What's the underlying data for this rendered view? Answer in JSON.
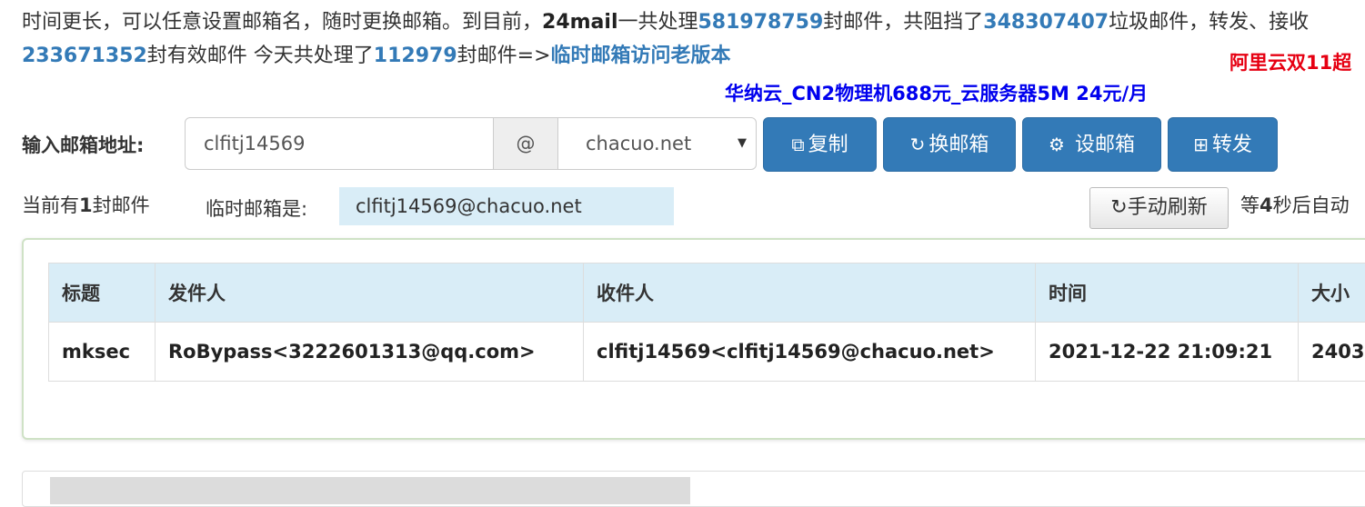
{
  "intro": {
    "line1_a": "时间更长，可以任意设置邮箱名，随时更换邮箱。到目前，",
    "brand": "24mail",
    "line1_b": "一共处理",
    "total": "581978759",
    "line1_c": "封邮件，共阻挡了",
    "blocked": "348307407",
    "line1_d": "垃圾邮件，转发、接收",
    "valid": "233671352",
    "line2_a": "封有效邮件 今天共处理了",
    "today": "112979",
    "line2_b": "封邮件=>",
    "old_version_link": "临时邮箱访问老版本"
  },
  "ads": {
    "aliyun": "阿里云双11超",
    "huana": "华纳云_CN2物理机688元_云服务器5M 24元/月"
  },
  "form": {
    "label": "输入邮箱地址:",
    "username": "clfitj14569",
    "at": "@",
    "domain": "chacuo.net",
    "copy": "复制",
    "change": "换邮箱",
    "set": "设邮箱",
    "forward": "转发"
  },
  "status": {
    "count_pre": "当前有",
    "count": "1",
    "count_post": "封邮件",
    "current_label": "临时邮箱是:",
    "current_email": "clfitj14569@chacuo.net",
    "refresh": "手动刷新",
    "wait_pre": "等",
    "wait_secs": "4",
    "wait_post": "秒后自动"
  },
  "table": {
    "headers": [
      "标题",
      "发件人",
      "收件人",
      "时间",
      "大小"
    ],
    "rows": [
      [
        "mksec",
        "RoBypass<3222601313@qq.com>",
        "clfitj14569<clfitj14569@chacuo.net>",
        "2021-12-22 21:09:21",
        "2403"
      ]
    ]
  },
  "colors": {
    "primary": "#337ab7",
    "header_bg": "#d9edf7",
    "ad_red": "#e60012",
    "ad_blue": "#0000ee"
  }
}
